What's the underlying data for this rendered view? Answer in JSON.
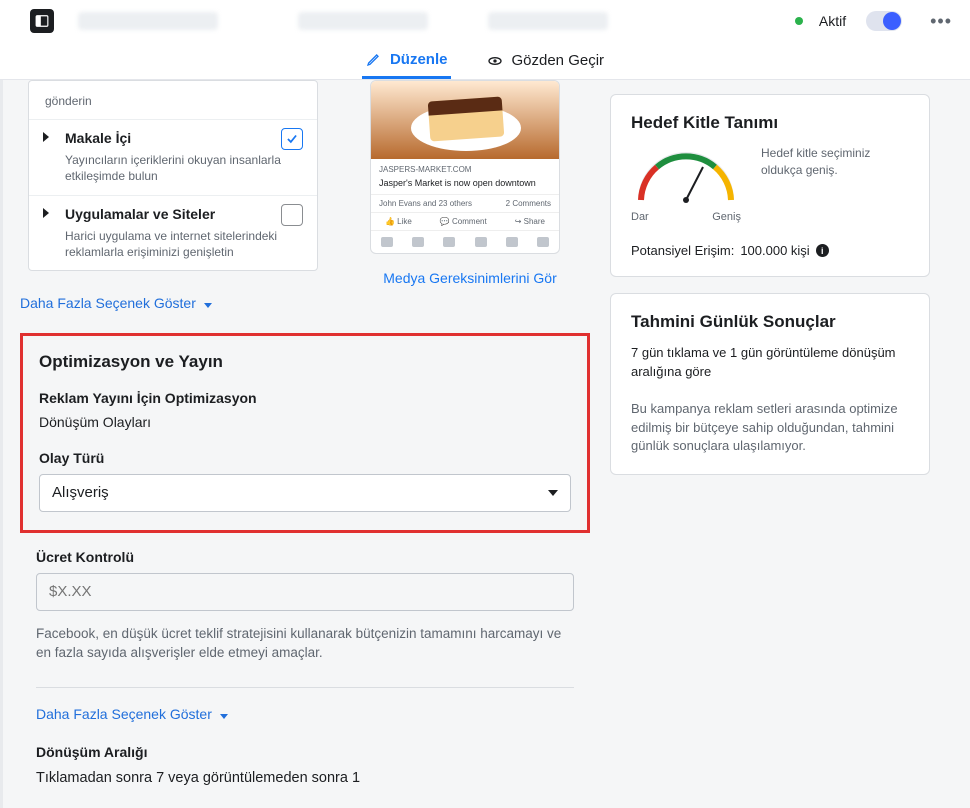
{
  "header": {
    "status_label": "Aktif"
  },
  "tabs": {
    "edit": "Düzenle",
    "review": "Gözden Geçir"
  },
  "placements": {
    "items": [
      {
        "title": "",
        "desc": "gönderin",
        "caret": false,
        "check": "none"
      },
      {
        "title": "Makale İçi",
        "desc": "Yayıncıların içeriklerini okuyan insanlarla etkileşimde bulun",
        "caret": true,
        "check": "checked"
      },
      {
        "title": "Uygulamalar ve Siteler",
        "desc": "Harici uygulama ve internet sitelerindeki reklamlarla erişiminizi genişletin",
        "caret": true,
        "check": "empty"
      }
    ]
  },
  "preview": {
    "domain": "JASPERS-MARKET.COM",
    "headline": "Jasper's Market is now open downtown",
    "reactions_left": "John Evans and 23 others",
    "reactions_right": "2 Comments",
    "like": "Like",
    "comment": "Comment",
    "share": "Share",
    "media_link": "Medya Gereksinimlerini Gör"
  },
  "more_options": "Daha Fazla Seçenek Göster",
  "optimization": {
    "section_title": "Optimizasyon ve Yayın",
    "opt_label": "Reklam Yayını İçin Optimizasyon",
    "opt_value": "Dönüşüm Olayları",
    "event_type_label": "Olay Türü",
    "event_type_value": "Alışveriş"
  },
  "cost": {
    "label": "Ücret Kontrolü",
    "placeholder": "$X.XX",
    "help": "Facebook, en düşük ücret teklif stratejisini kullanarak bütçenizin tamamını harcamayı ve en fazla sayıda alışverişler elde etmeyi amaçlar."
  },
  "more_options_2": "Daha Fazla Seçenek Göster",
  "conv_window": {
    "label": "Dönüşüm Aralığı",
    "value": "Tıklamadan sonra 7 veya görüntülemeden sonra 1"
  },
  "audience_card": {
    "title": "Hedef Kitle Tanımı",
    "desc": "Hedef kitle seçiminiz oldukça geniş.",
    "narrow": "Dar",
    "broad": "Geniş",
    "reach_label": "Potansiyel Erişim:",
    "reach_value": "100.000 kişi"
  },
  "results_card": {
    "title": "Tahmini Günlük Sonuçlar",
    "sub": "7 gün tıklama ve 1 gün görüntüleme dönüşüm aralığına göre",
    "body": "Bu kampanya reklam setleri arasında optimize edilmiş bir bütçeye sahip olduğundan, tahmini günlük sonuçlara ulaşılamıyor."
  }
}
